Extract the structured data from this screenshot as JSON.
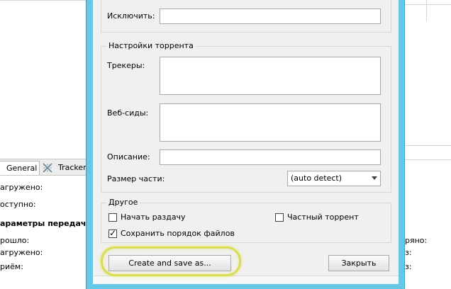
{
  "background_window": {
    "tabs": [
      {
        "label": "General"
      },
      {
        "label": "Tracker"
      }
    ],
    "left_labels": [
      {
        "text": "агружено:",
        "bold": false
      },
      {
        "text": "оступно:",
        "bold": false
      },
      {
        "text": "араметры передачи:",
        "bold": true
      },
      {
        "text": "рошло:",
        "bold": false
      },
      {
        "text": "агружено:",
        "bold": false
      },
      {
        "text": "риём:",
        "bold": false
      }
    ],
    "right_labels": [
      "ряно:",
      "з:",
      "з:"
    ]
  },
  "dialog": {
    "exclude_label": "Исключить:",
    "exclude_value": "",
    "torrent_settings": {
      "title": "Настройки торрента",
      "trackers_label": "Трекеры:",
      "trackers_value": "",
      "webseeds_label": "Веб-сиды:",
      "webseeds_value": "",
      "description_label": "Описание:",
      "description_value": "",
      "piece_size_label": "Размер части:",
      "piece_size_value": "(auto detect)"
    },
    "other": {
      "title": "Другое",
      "start_seeding": {
        "label": "Начать раздачу",
        "checked": false
      },
      "private_torrent": {
        "label": "Частный торрент",
        "checked": false
      },
      "preserve_order": {
        "label": "Сохранить порядок файлов",
        "checked": true
      }
    },
    "create_button": "Create and save as...",
    "close_button": "Закрыть"
  },
  "colors": {
    "frame": "#64c8e6",
    "highlight": "#d8dc56",
    "dialog_bg": "#f0f0f0"
  }
}
